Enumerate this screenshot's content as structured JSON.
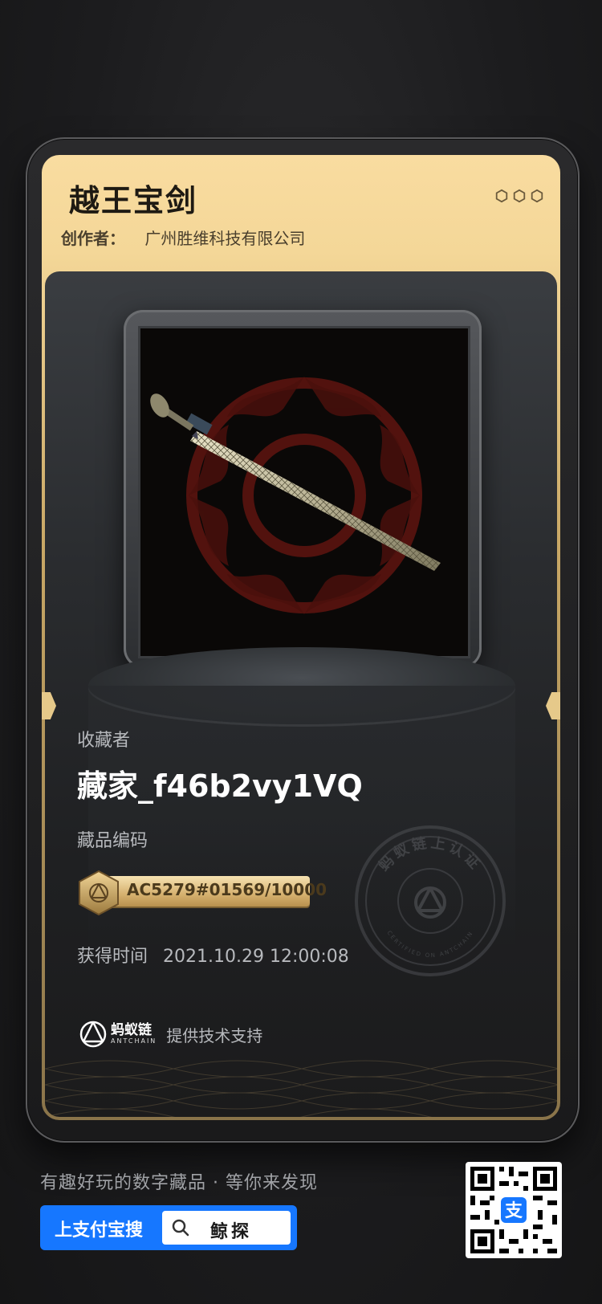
{
  "card": {
    "title": "越王宝剑",
    "creator_label": "创作者：",
    "creator_name": "广州胜维科技有限公司"
  },
  "collector": {
    "label": "收藏者",
    "value": "藏家_f46b2vy1VQ"
  },
  "item_code": {
    "label": "藏品编码",
    "value": "AC5279#01569/10000"
  },
  "acquired": {
    "label": "获得时间",
    "value": "2021.10.29 12:00:08"
  },
  "stamp": {
    "top_text": "蚂蚁链上认证",
    "bottom_text": "CERTIFIED ON ANTCHAIN"
  },
  "footer": {
    "brand_name": "蚂蚁链",
    "brand_sub": "ANTCHAIN",
    "support_text": "提供技术支持"
  },
  "promo": {
    "text": "有趣好玩的数字藏品 · 等你来发现",
    "search_label": "上支付宝搜",
    "search_keyword": "鲸探"
  },
  "colors": {
    "gold": "#f4d798",
    "alipay_blue": "#1677ff"
  }
}
